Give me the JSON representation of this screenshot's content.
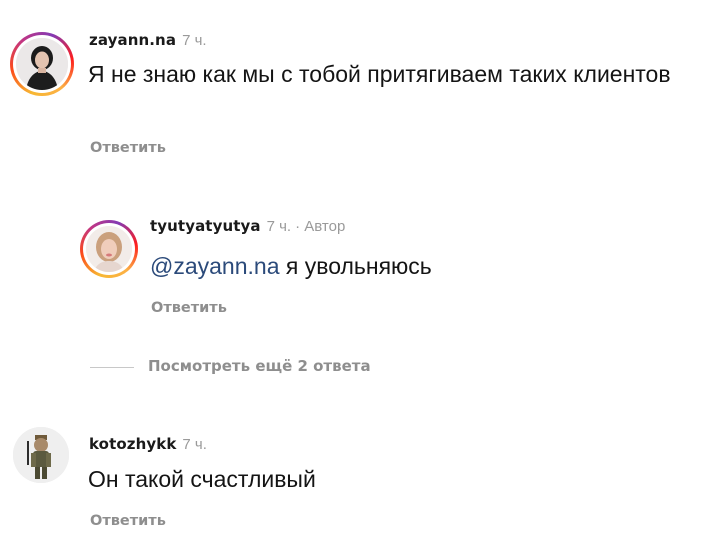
{
  "comments": [
    {
      "username": "zayann.na",
      "time": "7 ч.",
      "text": "Я не знаю как мы с тобой притягиваем таких клиентов",
      "reply_label": "Ответить"
    },
    {
      "username": "tyutyatyutya",
      "time": "7 ч.",
      "author_badge": "· Автор",
      "mention": "@zayann.na",
      "text": "я увольняюсь",
      "reply_label": "Ответить"
    },
    {
      "username": "kotozhykk",
      "time": "7 ч.",
      "text": "Он такой счастливый",
      "reply_label": "Ответить"
    }
  ],
  "view_more_replies": "Посмотреть ещё 2 ответа",
  "colors": {
    "username": "#1a1a1a",
    "meta": "#9a9a9a",
    "reply_link": "#8e8e8e",
    "mention": "#2b4a7a",
    "story_ring": "#c13584"
  },
  "icons": [
    "avatar-zayann",
    "avatar-tyutyatyutya",
    "avatar-kotozhykk"
  ]
}
